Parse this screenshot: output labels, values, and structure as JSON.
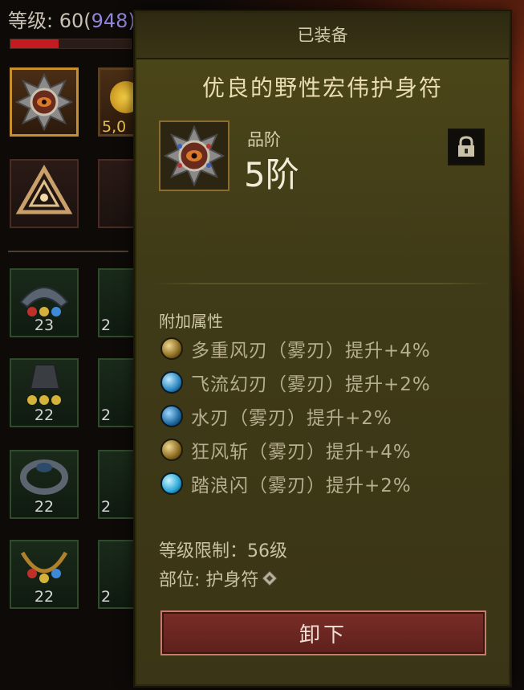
{
  "hud": {
    "level_label": "等级: 60(",
    "paragon_value": "94",
    "paragon_suffix": "8)",
    "health_fraction": 0.4
  },
  "inventory": {
    "gold_partial": "5,0",
    "slots": [
      {
        "level": "23",
        "level_partial": "2"
      },
      {
        "level": "22",
        "level_partial": "2"
      },
      {
        "level": "22",
        "level_partial": "2"
      },
      {
        "level": "22",
        "level_partial": "2"
      }
    ]
  },
  "tooltip": {
    "header": "已装备",
    "item_name": "优良的野性宏伟护身符",
    "item_icon": "amulet-eye-icon",
    "grade_label": "品阶",
    "grade_value": "5阶",
    "lock_icon": "lock-icon",
    "attributes_title": "附加属性",
    "attributes": [
      {
        "text": "多重风刃（雾刃）提升+4%",
        "icon": "gold-wind-orb",
        "color": "#c9a34a"
      },
      {
        "text": "飞流幻刃（雾刃）提升+2%",
        "icon": "blue-blade-orb",
        "color": "#4aa9d6"
      },
      {
        "text": "水刃（雾刃）提升+2%",
        "icon": "blue-water-orb",
        "color": "#3a8fc4"
      },
      {
        "text": "狂风斩（雾刃）提升+4%",
        "icon": "gold-gale-orb",
        "color": "#c9a34a"
      },
      {
        "text": "踏浪闪（雾刃）提升+2%",
        "icon": "blue-wave-orb",
        "color": "#43b6e0"
      }
    ],
    "level_requirement": "等级限制：56级",
    "slot_prefix": "部位: 护身符",
    "slot_icon": "amulet-slot-icon",
    "unequip_label": "卸下"
  }
}
